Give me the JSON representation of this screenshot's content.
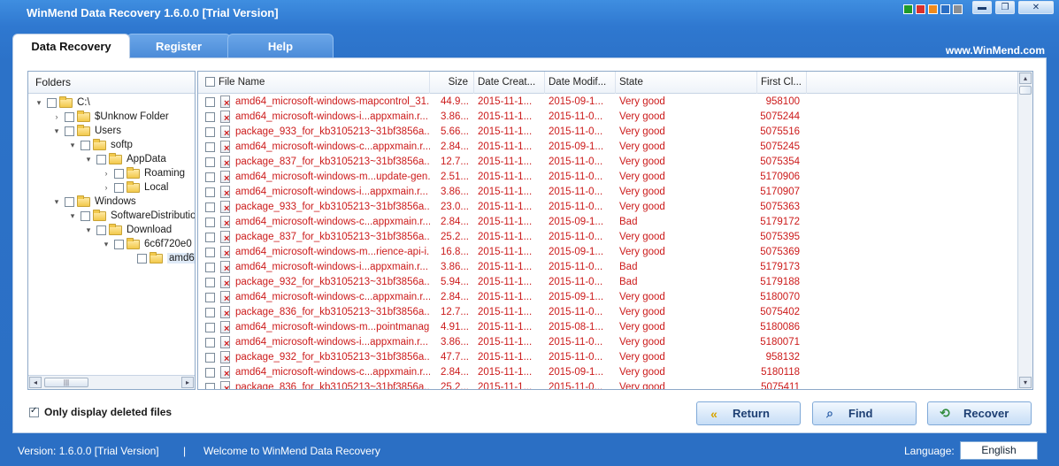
{
  "window": {
    "title": "WinMend Data Recovery 1.6.0.0 [Trial Version]",
    "swatches": [
      "#1f9a2a",
      "#d9302c",
      "#f08a1c",
      "#2a6ec4",
      "#8a8f96"
    ],
    "buttons": {
      "minimize": "▬",
      "maximize": "❐",
      "close": "✕"
    }
  },
  "tabs": [
    {
      "label": "Data Recovery",
      "active": true
    },
    {
      "label": "Register",
      "active": false
    },
    {
      "label": "Help",
      "active": false
    }
  ],
  "site_link": "www.WinMend.com",
  "folders": {
    "header": "Folders",
    "nodes": [
      {
        "label": "C:\\",
        "expanded": "▾"
      },
      {
        "label": "$Unknow Folder",
        "expanded": "›"
      },
      {
        "label": "Users",
        "expanded": "▾"
      },
      {
        "label": "softp",
        "expanded": "▾"
      },
      {
        "label": "AppData",
        "expanded": "▾"
      },
      {
        "label": "Roaming",
        "expanded": "›"
      },
      {
        "label": "Local",
        "expanded": "›"
      },
      {
        "label": "Windows",
        "expanded": "▾"
      },
      {
        "label": "SoftwareDistributio",
        "expanded": "▾"
      },
      {
        "label": "Download",
        "expanded": "▾"
      },
      {
        "label": "6c6f720e0",
        "expanded": "▾"
      },
      {
        "label": "amd64",
        "expanded": ""
      }
    ],
    "scroll_left": "◂",
    "scroll_right": "▸",
    "scroll_thumb": "|||"
  },
  "filelist": {
    "columns": [
      "File Name",
      "Size",
      "Date Creat...",
      "Date Modif...",
      "State",
      "First Cl..."
    ],
    "rows": [
      [
        "amd64_microsoft-windows-mapcontrol_31...",
        "44.9...",
        "2015-11-1...",
        "2015-09-1...",
        "Very good",
        "958100"
      ],
      [
        "amd64_microsoft-windows-i...appxmain.r...",
        "3.86...",
        "2015-11-1...",
        "2015-11-0...",
        "Very good",
        "5075244"
      ],
      [
        "package_933_for_kb3105213~31bf3856a...",
        "5.66...",
        "2015-11-1...",
        "2015-11-0...",
        "Very good",
        "5075516"
      ],
      [
        "amd64_microsoft-windows-c...appxmain.r...",
        "2.84...",
        "2015-11-1...",
        "2015-09-1...",
        "Very good",
        "5075245"
      ],
      [
        "package_837_for_kb3105213~31bf3856a...",
        "12.7...",
        "2015-11-1...",
        "2015-11-0...",
        "Very good",
        "5075354"
      ],
      [
        "amd64_microsoft-windows-m...update-gen...",
        "2.51...",
        "2015-11-1...",
        "2015-11-0...",
        "Very good",
        "5170906"
      ],
      [
        "amd64_microsoft-windows-i...appxmain.r...",
        "3.86...",
        "2015-11-1...",
        "2015-11-0...",
        "Very good",
        "5170907"
      ],
      [
        "package_933_for_kb3105213~31bf3856a...",
        "23.0...",
        "2015-11-1...",
        "2015-11-0...",
        "Very good",
        "5075363"
      ],
      [
        "amd64_microsoft-windows-c...appxmain.r...",
        "2.84...",
        "2015-11-1...",
        "2015-09-1...",
        "Bad",
        "5179172"
      ],
      [
        "package_837_for_kb3105213~31bf3856a...",
        "25.2...",
        "2015-11-1...",
        "2015-11-0...",
        "Very good",
        "5075395"
      ],
      [
        "amd64_microsoft-windows-m...rience-api-i...",
        "16.8...",
        "2015-11-1...",
        "2015-09-1...",
        "Very good",
        "5075369"
      ],
      [
        "amd64_microsoft-windows-i...appxmain.r...",
        "3.86...",
        "2015-11-1...",
        "2015-11-0...",
        "Bad",
        "5179173"
      ],
      [
        "package_932_for_kb3105213~31bf3856a...",
        "5.94...",
        "2015-11-1...",
        "2015-11-0...",
        "Bad",
        "5179188"
      ],
      [
        "amd64_microsoft-windows-c...appxmain.r...",
        "2.84...",
        "2015-11-1...",
        "2015-09-1...",
        "Very good",
        "5180070"
      ],
      [
        "package_836_for_kb3105213~31bf3856a...",
        "12.7...",
        "2015-11-1...",
        "2015-11-0...",
        "Very good",
        "5075402"
      ],
      [
        "amd64_microsoft-windows-m...pointmanag...",
        "4.91...",
        "2015-11-1...",
        "2015-08-1...",
        "Very good",
        "5180086"
      ],
      [
        "amd64_microsoft-windows-i...appxmain.r...",
        "3.86...",
        "2015-11-1...",
        "2015-11-0...",
        "Very good",
        "5180071"
      ],
      [
        "package_932_for_kb3105213~31bf3856a...",
        "47.7...",
        "2015-11-1...",
        "2015-11-0...",
        "Very good",
        "958132"
      ],
      [
        "amd64_microsoft-windows-c...appxmain.r...",
        "2.84...",
        "2015-11-1...",
        "2015-09-1...",
        "Very good",
        "5180118"
      ],
      [
        "package_836_for_kb3105213~31bf3856a...",
        "25.2...",
        "2015-11-1...",
        "2015-11-0...",
        "Very good",
        "5075411"
      ]
    ],
    "scroll_up": "▴",
    "scroll_down": "▾"
  },
  "only_deleted": {
    "label": "Only display deleted files",
    "checked": true
  },
  "actions": {
    "return": "Return",
    "find": "Find",
    "recover": "Recover"
  },
  "icons": {
    "return": "«",
    "find": "⌕",
    "recover": "⟲"
  },
  "status": {
    "version": "Version:  1.6.0.0 [Trial Version]",
    "separator": "|",
    "welcome": "Welcome to WinMend Data Recovery",
    "language_label": "Language:",
    "language_value": "English"
  },
  "colors": {
    "accent": "#2b6fc4",
    "deleted_text": "#cc1a1a"
  }
}
